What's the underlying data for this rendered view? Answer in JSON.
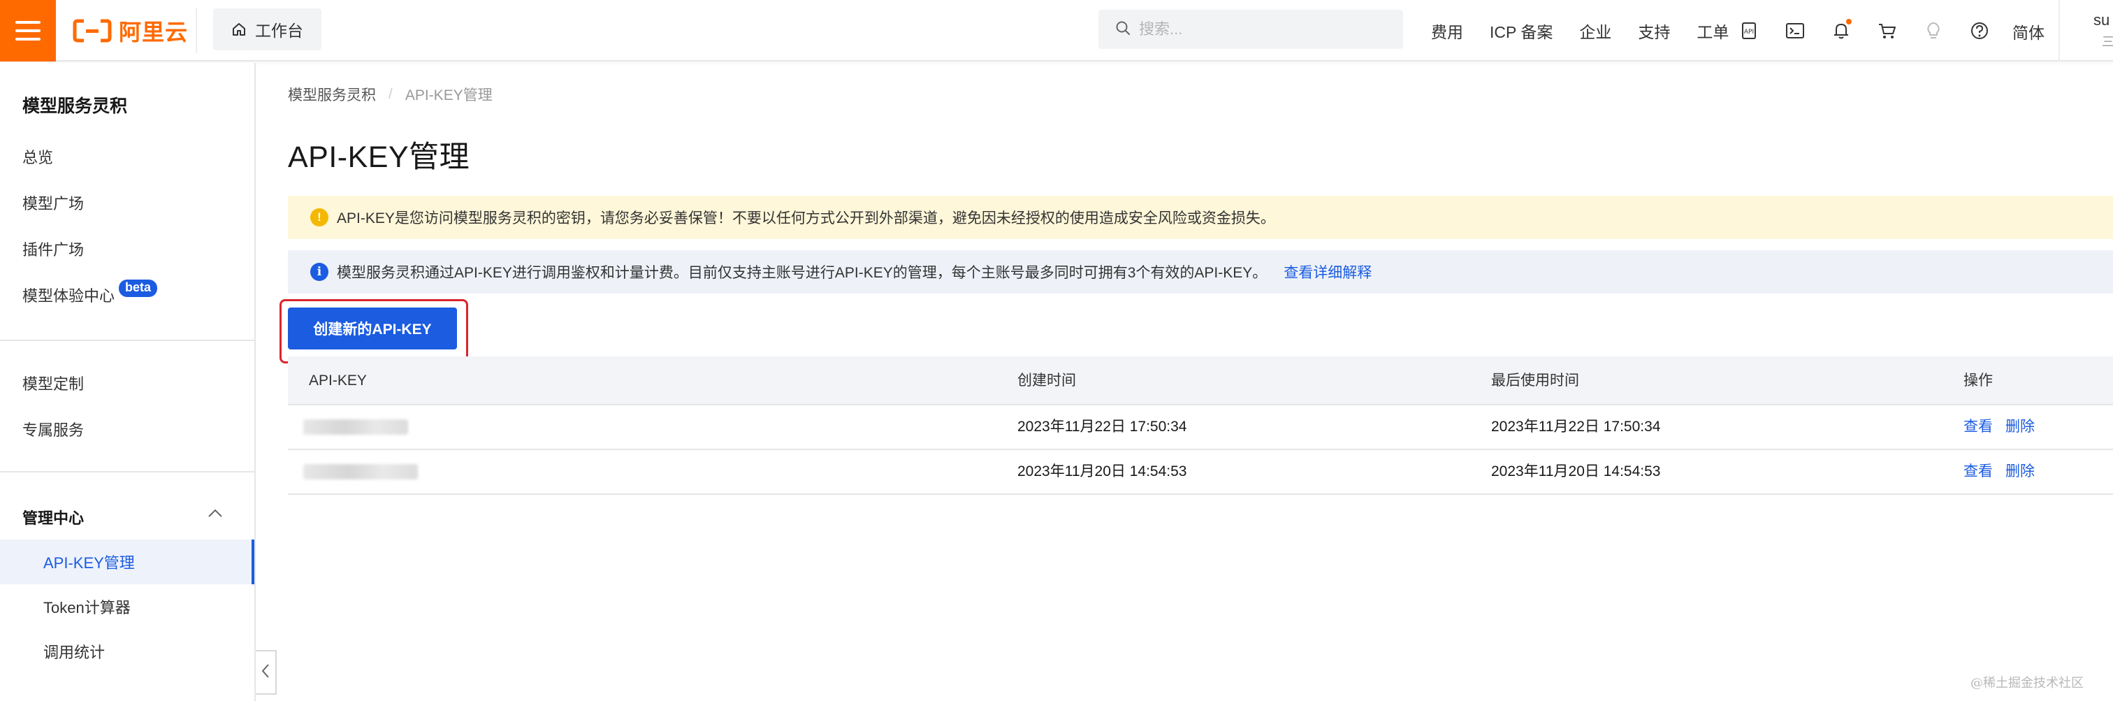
{
  "topbar": {
    "logo_text": "阿里云",
    "workbench_label": "工作台",
    "search_placeholder": "搜索...",
    "links": [
      "费用",
      "ICP 备案",
      "企业",
      "支持",
      "工单"
    ],
    "icons": [
      "api-icon",
      "terminal-icon",
      "bell-icon",
      "cart-icon",
      "bulb-icon",
      "help-icon"
    ],
    "language": "简体",
    "user_name": "su",
    "user_sub": "三"
  },
  "sidebar": {
    "title": "模型服务灵积",
    "items": [
      "总览",
      "模型广场",
      "插件广场",
      "模型体验中心"
    ],
    "beta_badge": "beta",
    "items2": [
      "模型定制",
      "专属服务"
    ],
    "section_title": "管理中心",
    "sub_items": [
      "API-KEY管理",
      "Token计算器",
      "调用统计"
    ]
  },
  "breadcrumb": {
    "root": "模型服务灵积",
    "separator": "/",
    "current": "API-KEY管理"
  },
  "page": {
    "title": "API-KEY管理",
    "warn_text": "API-KEY是您访问模型服务灵积的密钥，请您务必妥善保管！不要以任何方式公开到外部渠道，避免因未经授权的使用造成安全风险或资金损失。",
    "info_text": "模型服务灵积通过API-KEY进行调用鉴权和计量计费。目前仅支持主账号进行API-KEY的管理，每个主账号最多同时可拥有3个有效的API-KEY。",
    "info_link": "查看详细解释",
    "create_button": "创建新的API-KEY"
  },
  "table": {
    "columns": [
      "API-KEY",
      "创建时间",
      "最后使用时间",
      "操作"
    ],
    "rows": [
      {
        "created": "2023年11月22日 17:50:34",
        "last_used": "2023年11月22日 17:50:34",
        "view": "查看",
        "delete": "删除"
      },
      {
        "created": "2023年11月20日 14:54:53",
        "last_used": "2023年11月20日 14:54:53",
        "view": "查看",
        "delete": "删除"
      }
    ]
  },
  "watermark": "@稀土掘金技术社区",
  "colors": {
    "brand": "#ff6a00",
    "primary": "#1b5ce1",
    "warn_bg": "#fff7d9",
    "info_bg": "#eef2f8",
    "highlight": "#d9262c"
  }
}
